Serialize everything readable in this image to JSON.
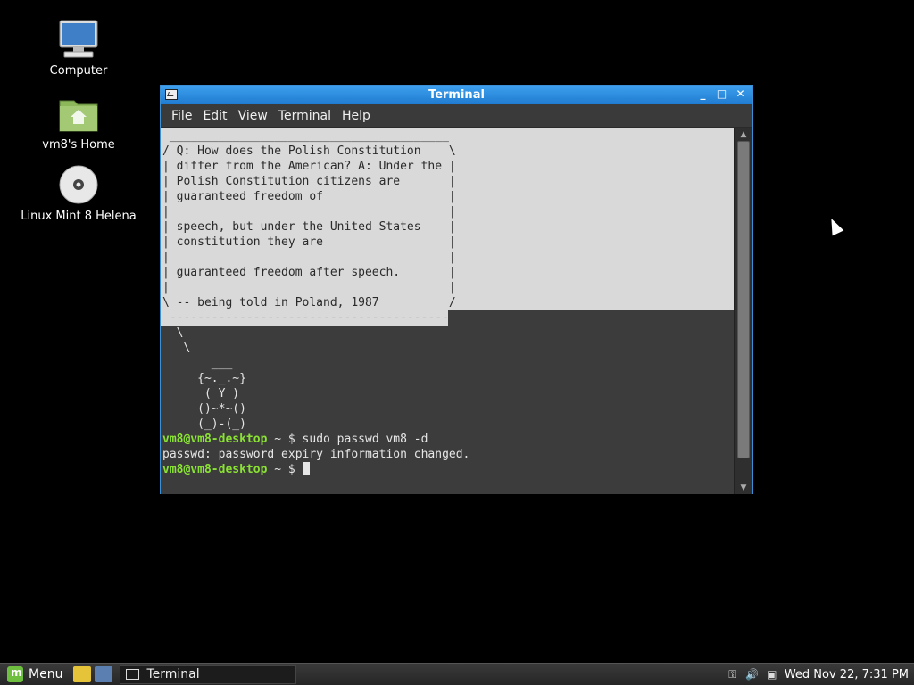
{
  "desktop": {
    "icons": [
      {
        "label": "Computer",
        "icon": "computer-icon"
      },
      {
        "label": "vm8's Home",
        "icon": "home-folder-icon"
      },
      {
        "label": "Linux Mint 8 Helena",
        "icon": "disc-icon"
      }
    ]
  },
  "window": {
    "title": "Terminal",
    "controls": {
      "minimize": "_",
      "maximize": "□",
      "close": "✕"
    },
    "menu": [
      "File",
      "Edit",
      "View",
      "Terminal",
      "Help"
    ]
  },
  "terminal": {
    "selected_lines": [
      " ________________________________________",
      "/ Q: How does the Polish Constitution    \\",
      "| differ from the American? A: Under the |",
      "| Polish Constitution citizens are       |",
      "| guaranteed freedom of                  |",
      "|                                        |",
      "| speech, but under the United States    |",
      "| constitution they are                  |",
      "|                                        |",
      "| guaranteed freedom after speech.       |",
      "|                                        |",
      "\\ -- being told in Poland, 1987          /",
      " ----------------------------------------"
    ],
    "art_lines": [
      "  \\",
      "   \\",
      "       ___",
      "     {~._.~}",
      "      ( Y )",
      "     ()~*~()",
      "     (_)-(_)"
    ],
    "command_prompt": "vm8@vm8-desktop",
    "prompt_suffix": " ~ $ ",
    "command": "sudo passwd vm8 -d",
    "output": "passwd: password expiry information changed.",
    "final_prompt": "vm8@vm8-desktop",
    "final_suffix": " ~ $ "
  },
  "taskbar": {
    "menu_label": "Menu",
    "task_label": "Terminal",
    "clock": "Wed Nov 22,  7:31 PM"
  }
}
